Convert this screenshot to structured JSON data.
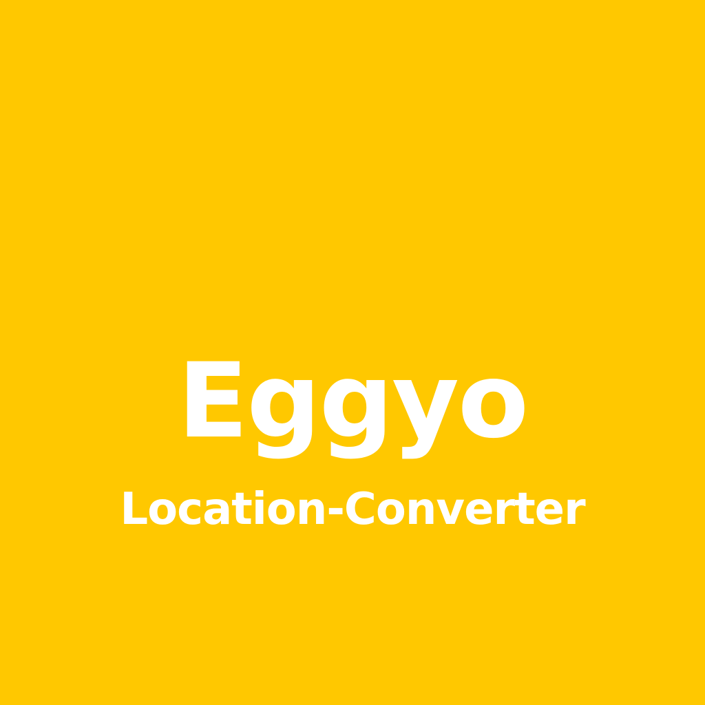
{
  "splash": {
    "background_color": "#FFC800",
    "text_color": "#FFFFFF",
    "app_name": "Eggyo",
    "subtitle": "Location-Converter"
  }
}
